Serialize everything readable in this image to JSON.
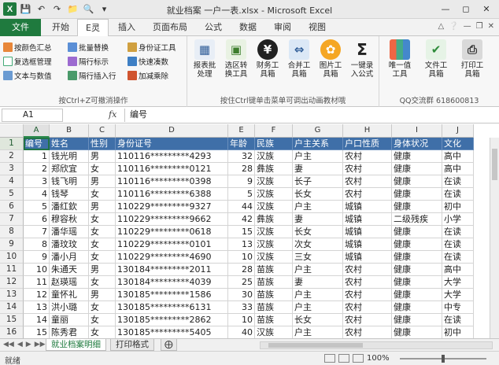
{
  "window": {
    "title": "就业档案 一户一表.xlsx - Microsoft Excel",
    "logo": "X"
  },
  "tabs": [
    {
      "label": "文件"
    },
    {
      "label": "开始"
    },
    {
      "label": "E灵"
    },
    {
      "label": "插入"
    },
    {
      "label": "页面布局"
    },
    {
      "label": "公式"
    },
    {
      "label": "数据"
    },
    {
      "label": "审阅"
    },
    {
      "label": "视图"
    }
  ],
  "ribbon": {
    "group1": {
      "items": [
        "按颜色汇总",
        "复选框管理",
        "文本与数值"
      ],
      "items2": [
        "批量替换",
        "隔行标示",
        "隔行插入行"
      ],
      "items3": [
        "身份证工具",
        "快速凑数",
        "加减乘除"
      ],
      "label": "按Ctrl+Z可撤消操作"
    },
    "group2": {
      "buttons": [
        {
          "line1": "报表批",
          "line2": "处理"
        },
        {
          "line1": "选区转",
          "line2": "换工具"
        },
        {
          "line1": "财务工",
          "line2": "具箱"
        },
        {
          "line1": "合并工",
          "line2": "具箱"
        },
        {
          "line1": "图片工",
          "line2": "具箱"
        },
        {
          "line1": "一键录",
          "line2": "入公式"
        }
      ],
      "label": "按住Ctrl键单击菜单可调出动画教材哦"
    },
    "group3": {
      "buttons": [
        {
          "line1": "唯一值",
          "line2": "工具"
        },
        {
          "line1": "文件工",
          "line2": "具箱"
        },
        {
          "line1": "打印工",
          "line2": "具箱"
        }
      ],
      "label": "QQ交流群 618600813"
    }
  },
  "formula_bar": {
    "name_box": "A1",
    "fx": "fx",
    "content": "编号"
  },
  "columns": [
    "A",
    "B",
    "C",
    "D",
    "E",
    "F",
    "G",
    "H",
    "I",
    "J"
  ],
  "row_numbers": [
    "1",
    "2",
    "3",
    "4",
    "5",
    "6",
    "7",
    "8",
    "9",
    "10",
    "11",
    "12",
    "13",
    "14",
    "15",
    "16"
  ],
  "table": {
    "headers": [
      "编号",
      "姓名",
      "性别",
      "身份证号",
      "年龄",
      "民族",
      "户主关系",
      "户口性质",
      "身体状况",
      "文化"
    ],
    "rows": [
      [
        "1",
        "钱光明",
        "男",
        "110116*********4293",
        "32",
        "汉族",
        "户主",
        "农村",
        "健康",
        "高中"
      ],
      [
        "2",
        "郑欣宜",
        "女",
        "110116*********0121",
        "28",
        "彝族",
        "妻",
        "农村",
        "健康",
        "高中"
      ],
      [
        "3",
        "钱飞明",
        "男",
        "110116*********0398",
        "9",
        "汉族",
        "长子",
        "农村",
        "健康",
        "在读"
      ],
      [
        "4",
        "钱琴",
        "女",
        "110116*********6388",
        "5",
        "汉族",
        "长女",
        "农村",
        "健康",
        "在读"
      ],
      [
        "5",
        "潘红欽",
        "男",
        "110229*********9327",
        "44",
        "汉族",
        "户主",
        "城镇",
        "健康",
        "初中"
      ],
      [
        "6",
        "穆容秋",
        "女",
        "110229*********9662",
        "42",
        "彝族",
        "妻",
        "城镇",
        "二级残疾",
        "小学"
      ],
      [
        "7",
        "潘华瑶",
        "女",
        "110229*********0618",
        "15",
        "汉族",
        "长女",
        "城镇",
        "健康",
        "在读"
      ],
      [
        "8",
        "潘玟玟",
        "女",
        "110229*********0101",
        "13",
        "汉族",
        "次女",
        "城镇",
        "健康",
        "在读"
      ],
      [
        "9",
        "潘小月",
        "女",
        "110229*********4690",
        "10",
        "汉族",
        "三女",
        "城镇",
        "健康",
        "在读"
      ],
      [
        "10",
        "朱通天",
        "男",
        "130184*********2011",
        "28",
        "苗族",
        "户主",
        "农村",
        "健康",
        "高中"
      ],
      [
        "11",
        "赵瑛瑶",
        "女",
        "130184*********4039",
        "25",
        "苗族",
        "妻",
        "农村",
        "健康",
        "大学"
      ],
      [
        "12",
        "童怀礼",
        "男",
        "130185*********1586",
        "30",
        "苗族",
        "户主",
        "农村",
        "健康",
        "大学"
      ],
      [
        "13",
        "洪小璐",
        "女",
        "130185*********6131",
        "33",
        "苗族",
        "户主",
        "农村",
        "健康",
        "中专"
      ],
      [
        "14",
        "童丽",
        "女",
        "130185*********2862",
        "10",
        "苗族",
        "长女",
        "农村",
        "健康",
        "在读"
      ],
      [
        "15",
        "陈秀君",
        "女",
        "130185*********5405",
        "40",
        "汉族",
        "户主",
        "农村",
        "健康",
        "初中"
      ]
    ]
  },
  "sheets": [
    {
      "label": "就业档案明细"
    },
    {
      "label": "打印格式"
    }
  ],
  "status": {
    "ready": "就绪",
    "zoom": "100%",
    "zoom_fraction": 0.5
  }
}
